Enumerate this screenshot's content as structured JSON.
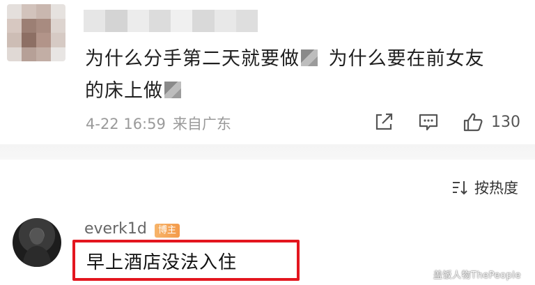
{
  "comment1": {
    "text_part1": "为什么分手第二天就要做",
    "text_part2": " 为什么要在前女友",
    "text_part3": "的床上做",
    "date": "4-22 16:59",
    "location": "来自广东",
    "share_icon": "share-icon",
    "reply_icon": "comment-icon",
    "like_icon": "thumbs-up-icon",
    "like_count": "130"
  },
  "sort": {
    "icon": "sort-icon",
    "label": "按热度"
  },
  "comment2": {
    "username": "everk1d",
    "badge": "博主",
    "text": "早上酒店没法入住"
  },
  "watermark": "盖饭人物ThePeople",
  "colors": {
    "highlight_border": "#e3161f",
    "meta_gray": "#9a9a9a",
    "badge_orange": "#f49a4a"
  }
}
